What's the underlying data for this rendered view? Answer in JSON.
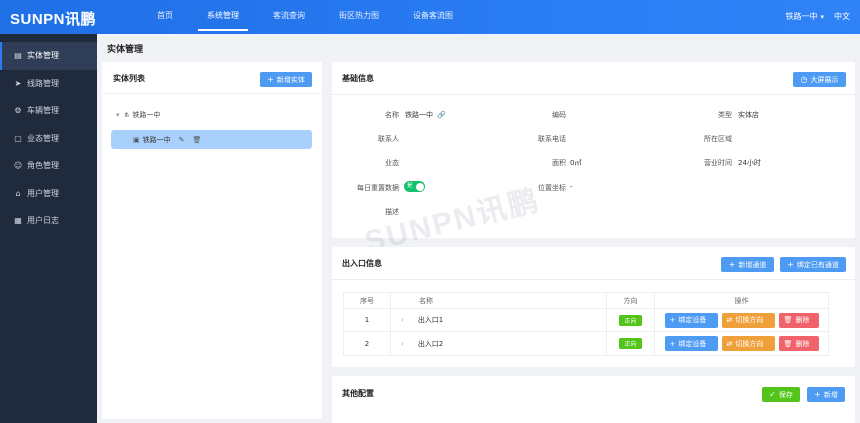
{
  "brand": "SUNPN讯鹏",
  "nav": [
    "首页",
    "系统管理",
    "客流查询",
    "街区热力图",
    "设备客流图"
  ],
  "header": {
    "current_entity": "铁路一中",
    "language": "中文"
  },
  "sidebar": {
    "items": [
      {
        "label": "实体管理",
        "icon": "building-icon"
      },
      {
        "label": "线路管理",
        "icon": "send-icon"
      },
      {
        "label": "车辆管理",
        "icon": "settings-icon"
      },
      {
        "label": "业态管理",
        "icon": "bag-icon"
      },
      {
        "label": "角色管理",
        "icon": "user-icon"
      },
      {
        "label": "用户管理",
        "icon": "home-icon"
      },
      {
        "label": "用户日志",
        "icon": "calendar-icon"
      }
    ]
  },
  "page_title": "实体管理",
  "entity_list": {
    "title": "实体列表",
    "add_button": "新增实体",
    "root": "铁路一中",
    "node": "铁路一中"
  },
  "basic_info": {
    "title": "基础信息",
    "fullscreen_button": "大屏展示",
    "fields": {
      "name_label": "名称",
      "name_value": "铁路一中",
      "code_label": "编码",
      "code_value": "",
      "type_label": "类型",
      "type_value": "实体店",
      "contact_label": "联系人",
      "contact_value": "",
      "phone_label": "联系电话",
      "phone_value": "",
      "region_label": "所在区域",
      "region_value": "",
      "biz_label": "业态",
      "biz_value": "",
      "area_label": "面积",
      "area_value": "0㎡",
      "hours_label": "营业时间",
      "hours_value": "24小时",
      "reset_label": "每日重置数据",
      "reset_toggle": "是",
      "coord_label": "位置坐标",
      "coord_value": "-",
      "desc_label": "描述",
      "desc_value": ""
    },
    "watermark": "SUNPN讯鹏"
  },
  "exits": {
    "title": "出入口信息",
    "add_button": "新增通道",
    "bind_button": "绑定已有通道",
    "columns": [
      "序号",
      "名称",
      "方向",
      "操作"
    ],
    "rows": [
      {
        "no": "1",
        "name": "出入口1",
        "direction": "正向"
      },
      {
        "no": "2",
        "name": "出入口2",
        "direction": "正向"
      }
    ],
    "row_actions": {
      "bind": "绑定设备",
      "switch": "切换方向",
      "delete": "删除"
    }
  },
  "other": {
    "title": "其他配置",
    "save_button": "保存",
    "add_button": "新增"
  }
}
